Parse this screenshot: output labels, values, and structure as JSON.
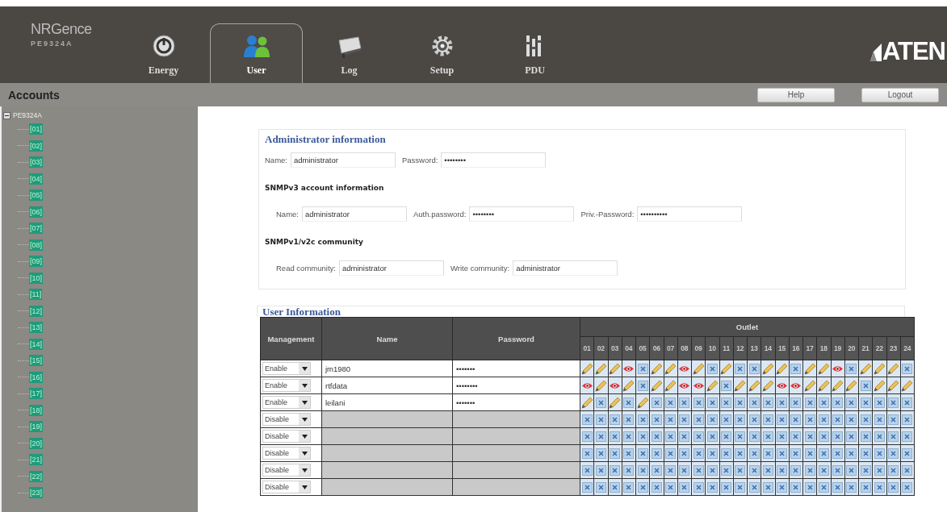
{
  "header": {
    "logo": {
      "name": "NRGence",
      "model": "PE9324A"
    },
    "tabs": [
      {
        "label": "Energy",
        "kind": "energy",
        "selected": false
      },
      {
        "label": "User",
        "kind": "user",
        "selected": true
      },
      {
        "label": "Log",
        "kind": "log",
        "selected": false
      },
      {
        "label": "Setup",
        "kind": "setup",
        "selected": false
      },
      {
        "label": "PDU",
        "kind": "pdu",
        "selected": false
      }
    ],
    "brand": "ATEN"
  },
  "toolbar": {
    "title": "Accounts",
    "buttons": [
      "Help",
      "Logout"
    ]
  },
  "sidebar": {
    "root": {
      "label": "PE9324A",
      "expanded": true,
      "children": [
        {
          "label": "[01]"
        },
        {
          "label": "[02]"
        },
        {
          "label": "[03]"
        },
        {
          "label": "[04]"
        },
        {
          "label": "[05]"
        },
        {
          "label": "[06]"
        },
        {
          "label": "[07]"
        },
        {
          "label": "[08]"
        },
        {
          "label": "[09]"
        },
        {
          "label": "[10]"
        },
        {
          "label": "[11]"
        },
        {
          "label": "[12]"
        },
        {
          "label": "[13]"
        },
        {
          "label": "[14]"
        },
        {
          "label": "[15]"
        },
        {
          "label": "[16]"
        },
        {
          "label": "[17]"
        },
        {
          "label": "[18]"
        },
        {
          "label": "[19]"
        },
        {
          "label": "[20]"
        },
        {
          "label": "[21]"
        },
        {
          "label": "[22]"
        },
        {
          "label": "[23]"
        }
      ]
    }
  },
  "admin": {
    "title": "Administrator information",
    "fields": [
      {
        "label": "Name:",
        "value": "administrator"
      },
      {
        "label": "Password:",
        "value": "••••••••"
      }
    ],
    "sections": [
      {
        "title": "SNMPv3 account information",
        "fields": [
          {
            "label": "Name:",
            "value": "administrator"
          },
          {
            "label": "Auth.password:",
            "value": "••••••••"
          },
          {
            "label": "Priv.-Password:",
            "value": "••••••••••"
          }
        ]
      },
      {
        "title": "SNMPv1/v2c community",
        "fields": [
          {
            "label": "Read community:",
            "value": "administrator"
          },
          {
            "label": "Write community:",
            "value": "administrator"
          }
        ]
      }
    ]
  },
  "users": {
    "title": "User Information",
    "columns": [
      "Management",
      "Name",
      "Password"
    ],
    "outlet_header": "Outlet",
    "outlet_numbers": [
      "01",
      "02",
      "03",
      "04",
      "05",
      "06",
      "07",
      "08",
      "09",
      "10",
      "11",
      "12",
      "13",
      "14",
      "15",
      "16",
      "17",
      "18",
      "19",
      "20",
      "21",
      "22",
      "23",
      "24"
    ],
    "rows": [
      {
        "management": "Enable",
        "disabled": false,
        "name": "jm1980",
        "password": "•••••••",
        "outlets": [
          {
            "kind": "full"
          },
          {
            "kind": "full"
          },
          {
            "kind": "full"
          },
          {
            "kind": "view"
          },
          {
            "kind": "none"
          },
          {
            "kind": "full"
          },
          {
            "kind": "full"
          },
          {
            "kind": "view"
          },
          {
            "kind": "full"
          },
          {
            "kind": "none"
          },
          {
            "kind": "full"
          },
          {
            "kind": "none"
          },
          {
            "kind": "none"
          },
          {
            "kind": "full"
          },
          {
            "kind": "full"
          },
          {
            "kind": "none"
          },
          {
            "kind": "full"
          },
          {
            "kind": "full"
          },
          {
            "kind": "view"
          },
          {
            "kind": "none"
          },
          {
            "kind": "full"
          },
          {
            "kind": "full"
          },
          {
            "kind": "full"
          },
          {
            "kind": "none"
          }
        ]
      },
      {
        "management": "Enable",
        "disabled": false,
        "name": "rtfdata",
        "password": "••••••••",
        "outlets": [
          {
            "kind": "view"
          },
          {
            "kind": "full"
          },
          {
            "kind": "view"
          },
          {
            "kind": "full"
          },
          {
            "kind": "none"
          },
          {
            "kind": "full"
          },
          {
            "kind": "full"
          },
          {
            "kind": "view"
          },
          {
            "kind": "view"
          },
          {
            "kind": "full"
          },
          {
            "kind": "none"
          },
          {
            "kind": "full"
          },
          {
            "kind": "full"
          },
          {
            "kind": "full"
          },
          {
            "kind": "view"
          },
          {
            "kind": "view"
          },
          {
            "kind": "full"
          },
          {
            "kind": "full"
          },
          {
            "kind": "full"
          },
          {
            "kind": "full"
          },
          {
            "kind": "none"
          },
          {
            "kind": "full"
          },
          {
            "kind": "full"
          },
          {
            "kind": "full"
          }
        ]
      },
      {
        "management": "Enable",
        "disabled": false,
        "name": "leilani",
        "password": "•••••••",
        "outlets": [
          {
            "kind": "full"
          },
          {
            "kind": "none"
          },
          {
            "kind": "full"
          },
          {
            "kind": "none"
          },
          {
            "kind": "full"
          },
          {
            "kind": "none"
          },
          {
            "kind": "none"
          },
          {
            "kind": "none"
          },
          {
            "kind": "none"
          },
          {
            "kind": "none"
          },
          {
            "kind": "none"
          },
          {
            "kind": "none"
          },
          {
            "kind": "none"
          },
          {
            "kind": "none"
          },
          {
            "kind": "none"
          },
          {
            "kind": "none"
          },
          {
            "kind": "none"
          },
          {
            "kind": "none"
          },
          {
            "kind": "none"
          },
          {
            "kind": "none"
          },
          {
            "kind": "none"
          },
          {
            "kind": "none"
          },
          {
            "kind": "none"
          },
          {
            "kind": "none"
          }
        ]
      },
      {
        "management": "Disable",
        "disabled": true,
        "outlets": [
          {
            "kind": "none"
          },
          {
            "kind": "none"
          },
          {
            "kind": "none"
          },
          {
            "kind": "none"
          },
          {
            "kind": "none"
          },
          {
            "kind": "none"
          },
          {
            "kind": "none"
          },
          {
            "kind": "none"
          },
          {
            "kind": "none"
          },
          {
            "kind": "none"
          },
          {
            "kind": "none"
          },
          {
            "kind": "none"
          },
          {
            "kind": "none"
          },
          {
            "kind": "none"
          },
          {
            "kind": "none"
          },
          {
            "kind": "none"
          },
          {
            "kind": "none"
          },
          {
            "kind": "none"
          },
          {
            "kind": "none"
          },
          {
            "kind": "none"
          },
          {
            "kind": "none"
          },
          {
            "kind": "none"
          },
          {
            "kind": "none"
          },
          {
            "kind": "none"
          }
        ]
      },
      {
        "management": "Disable",
        "disabled": true,
        "outlets": [
          {
            "kind": "none"
          },
          {
            "kind": "none"
          },
          {
            "kind": "none"
          },
          {
            "kind": "none"
          },
          {
            "kind": "none"
          },
          {
            "kind": "none"
          },
          {
            "kind": "none"
          },
          {
            "kind": "none"
          },
          {
            "kind": "none"
          },
          {
            "kind": "none"
          },
          {
            "kind": "none"
          },
          {
            "kind": "none"
          },
          {
            "kind": "none"
          },
          {
            "kind": "none"
          },
          {
            "kind": "none"
          },
          {
            "kind": "none"
          },
          {
            "kind": "none"
          },
          {
            "kind": "none"
          },
          {
            "kind": "none"
          },
          {
            "kind": "none"
          },
          {
            "kind": "none"
          },
          {
            "kind": "none"
          },
          {
            "kind": "none"
          },
          {
            "kind": "none"
          }
        ]
      },
      {
        "management": "Disable",
        "disabled": true,
        "outlets": [
          {
            "kind": "none"
          },
          {
            "kind": "none"
          },
          {
            "kind": "none"
          },
          {
            "kind": "none"
          },
          {
            "kind": "none"
          },
          {
            "kind": "none"
          },
          {
            "kind": "none"
          },
          {
            "kind": "none"
          },
          {
            "kind": "none"
          },
          {
            "kind": "none"
          },
          {
            "kind": "none"
          },
          {
            "kind": "none"
          },
          {
            "kind": "none"
          },
          {
            "kind": "none"
          },
          {
            "kind": "none"
          },
          {
            "kind": "none"
          },
          {
            "kind": "none"
          },
          {
            "kind": "none"
          },
          {
            "kind": "none"
          },
          {
            "kind": "none"
          },
          {
            "kind": "none"
          },
          {
            "kind": "none"
          },
          {
            "kind": "none"
          },
          {
            "kind": "none"
          }
        ]
      },
      {
        "management": "Disable",
        "disabled": true,
        "outlets": [
          {
            "kind": "none"
          },
          {
            "kind": "none"
          },
          {
            "kind": "none"
          },
          {
            "kind": "none"
          },
          {
            "kind": "none"
          },
          {
            "kind": "none"
          },
          {
            "kind": "none"
          },
          {
            "kind": "none"
          },
          {
            "kind": "none"
          },
          {
            "kind": "none"
          },
          {
            "kind": "none"
          },
          {
            "kind": "none"
          },
          {
            "kind": "none"
          },
          {
            "kind": "none"
          },
          {
            "kind": "none"
          },
          {
            "kind": "none"
          },
          {
            "kind": "none"
          },
          {
            "kind": "none"
          },
          {
            "kind": "none"
          },
          {
            "kind": "none"
          },
          {
            "kind": "none"
          },
          {
            "kind": "none"
          },
          {
            "kind": "none"
          },
          {
            "kind": "none"
          }
        ]
      },
      {
        "management": "Disable",
        "disabled": true,
        "outlets": [
          {
            "kind": "none"
          },
          {
            "kind": "none"
          },
          {
            "kind": "none"
          },
          {
            "kind": "none"
          },
          {
            "kind": "none"
          },
          {
            "kind": "none"
          },
          {
            "kind": "none"
          },
          {
            "kind": "none"
          },
          {
            "kind": "none"
          },
          {
            "kind": "none"
          },
          {
            "kind": "none"
          },
          {
            "kind": "none"
          },
          {
            "kind": "none"
          },
          {
            "kind": "none"
          },
          {
            "kind": "none"
          },
          {
            "kind": "none"
          },
          {
            "kind": "none"
          },
          {
            "kind": "none"
          },
          {
            "kind": "none"
          },
          {
            "kind": "none"
          },
          {
            "kind": "none"
          },
          {
            "kind": "none"
          },
          {
            "kind": "none"
          },
          {
            "kind": "none"
          }
        ]
      }
    ]
  }
}
